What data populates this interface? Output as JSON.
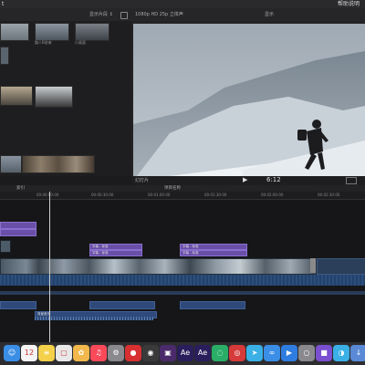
{
  "menubar": {
    "title": "t",
    "right_text": "帮助说明"
  },
  "browser": {
    "toolbar_text": "显示片段 ↕",
    "clips": [
      {
        "label": ""
      },
      {
        "label": "路人B进来"
      },
      {
        "label": "小画面"
      },
      {
        "label": ""
      },
      {
        "label": ""
      },
      {
        "label": ""
      },
      {
        "label": ""
      }
    ]
  },
  "viewer": {
    "bar_text": "1080p HD 25p  立体声",
    "bar_right": "显示"
  },
  "transport": {
    "timecode": "6:12",
    "label": "幻灯片"
  },
  "timeline": {
    "index_label": "索引",
    "project": "项目名称",
    "ruler": [
      "00:00:00:00",
      "00:00:30:00",
      "00:01:00:00",
      "00:01:30:00",
      "00:02:00:00",
      "00:02:30:00"
    ],
    "titles": [
      "字幕 - 标准",
      "字幕 - 标准",
      "字幕 - 标准",
      "字幕 - 标准"
    ],
    "audio_labels": [
      "背景音乐",
      "音频"
    ]
  },
  "dock": {
    "apps": [
      {
        "name": "finder",
        "glyph": "☺",
        "color": "#3a8ee6"
      },
      {
        "name": "calendar",
        "glyph": "12",
        "color": "#f4f4f4"
      },
      {
        "name": "notes",
        "glyph": "≡",
        "color": "#f5d04a"
      },
      {
        "name": "files",
        "glyph": "▢",
        "color": "#e8e8e8"
      },
      {
        "name": "photos",
        "glyph": "✿",
        "color": "#f2b84b"
      },
      {
        "name": "music",
        "glyph": "♫",
        "color": "#fa4a5a"
      },
      {
        "name": "preferences",
        "glyph": "⚙",
        "color": "#8a8a8e"
      },
      {
        "name": "app-red",
        "glyph": "●",
        "color": "#d83030"
      },
      {
        "name": "davinci",
        "glyph": "◉",
        "color": "#3a3a3a"
      },
      {
        "name": "final-cut",
        "glyph": "▣",
        "color": "#4a2a6a"
      },
      {
        "name": "after-effects",
        "glyph": "Ae",
        "color": "#2b1e5c"
      },
      {
        "name": "after-effects-2",
        "glyph": "Ae",
        "color": "#2b1e5c"
      },
      {
        "name": "wechat",
        "glyph": "◌",
        "color": "#2aae67"
      },
      {
        "name": "netease",
        "glyph": "◎",
        "color": "#d63a3a"
      },
      {
        "name": "feishu",
        "glyph": "➤",
        "color": "#3ab0e6"
      },
      {
        "name": "baidu",
        "glyph": "∞",
        "color": "#3a8ee6"
      },
      {
        "name": "tencent-video",
        "glyph": "▶",
        "color": "#2f7de0"
      },
      {
        "name": "utility",
        "glyph": "○",
        "color": "#8a8a8e"
      },
      {
        "name": "screen",
        "glyph": "■",
        "color": "#7a4fd0"
      },
      {
        "name": "bilibili",
        "glyph": "◑",
        "color": "#3ab0e6"
      },
      {
        "name": "downloads",
        "glyph": "↓",
        "color": "#5a8ad6"
      }
    ]
  }
}
